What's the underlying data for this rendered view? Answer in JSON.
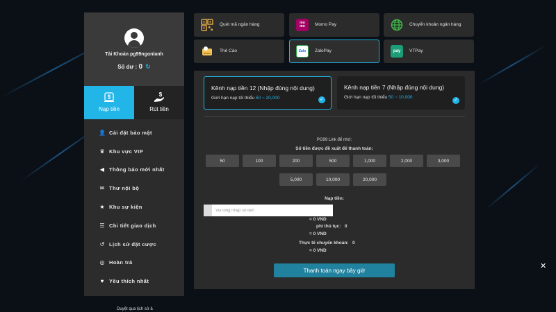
{
  "account": {
    "name": "Tài Khoản pg99ngonlanh",
    "balance_label": "Số dư :",
    "balance_value": "0"
  },
  "tabs": [
    {
      "label": "Nạp tiền"
    },
    {
      "label": "Rút tiền"
    }
  ],
  "menu": [
    {
      "label": "Cài đặt bảo mật",
      "icon": "user-lock-icon"
    },
    {
      "label": "Khu vực VIP",
      "icon": "crown-icon"
    },
    {
      "label": "Thông báo mới nhất",
      "icon": "megaphone-icon"
    },
    {
      "label": "Thư nội bộ",
      "icon": "envelope-icon"
    },
    {
      "label": "Khu sự kiện",
      "icon": "trophy-icon"
    },
    {
      "label": "Chi tiết giao dịch",
      "icon": "document-icon"
    },
    {
      "label": "Lịch sử đặt cược",
      "icon": "history-icon"
    },
    {
      "label": "Hoàn trả",
      "icon": "refund-icon"
    },
    {
      "label": "Yêu thích nhất",
      "icon": "heart-icon"
    }
  ],
  "bottom_note": "Duyệt qua lịch sử ả",
  "payment_methods": [
    {
      "label": "Quét mã ngân hàng",
      "icon": "qr-code-icon"
    },
    {
      "label": "Momo Pay",
      "icon": "momo-icon"
    },
    {
      "label": "Chuyển khoản ngân hàng",
      "icon": "globe-icon"
    },
    {
      "label": "Thẻ Cào",
      "icon": "scratch-card-icon"
    },
    {
      "label": "ZaloPay",
      "icon": "zalopay-icon"
    },
    {
      "label": "VTPay",
      "icon": "vtpay-icon"
    }
  ],
  "channels": [
    {
      "title": "Kênh nạp tiền 12 (Nhập đúng nội dung)",
      "limit_label": "Giới hạn nạp tối thiểu",
      "min": "50",
      "sep": "~",
      "max": "20,000"
    },
    {
      "title": "Kênh nạp tiền 7 (Nhập đúng nội dung)",
      "limit_label": "Giới hạn nạp tối thiểu",
      "min": "50",
      "sep": "~",
      "max": "10,000"
    }
  ],
  "link_note": "PG99 Link để nhớ:",
  "suggest_label": "Số tiền được đề xuất để thanh toán:",
  "amounts": [
    "50",
    "100",
    "200",
    "500",
    "1,000",
    "2,000",
    "3,000",
    "5,000",
    "10,000",
    "20,000"
  ],
  "deposit": {
    "label": "Nạp tiền:",
    "placeholder": "Vui lòng nhập số tiền",
    "equals_1": "= 0 VND",
    "fee_label": "phí thủ tục:",
    "fee_value": "0",
    "equals_2": "= 0 VND",
    "actual_label": "Thực tế chuyển khoản:",
    "actual_value": "0",
    "equals_3": "= 0 VND"
  },
  "pay_button": "Thanh toán ngay bây giờ",
  "colors": {
    "accent": "#21b5e8",
    "panel": "#2b2b2b",
    "button": "#21829f"
  }
}
